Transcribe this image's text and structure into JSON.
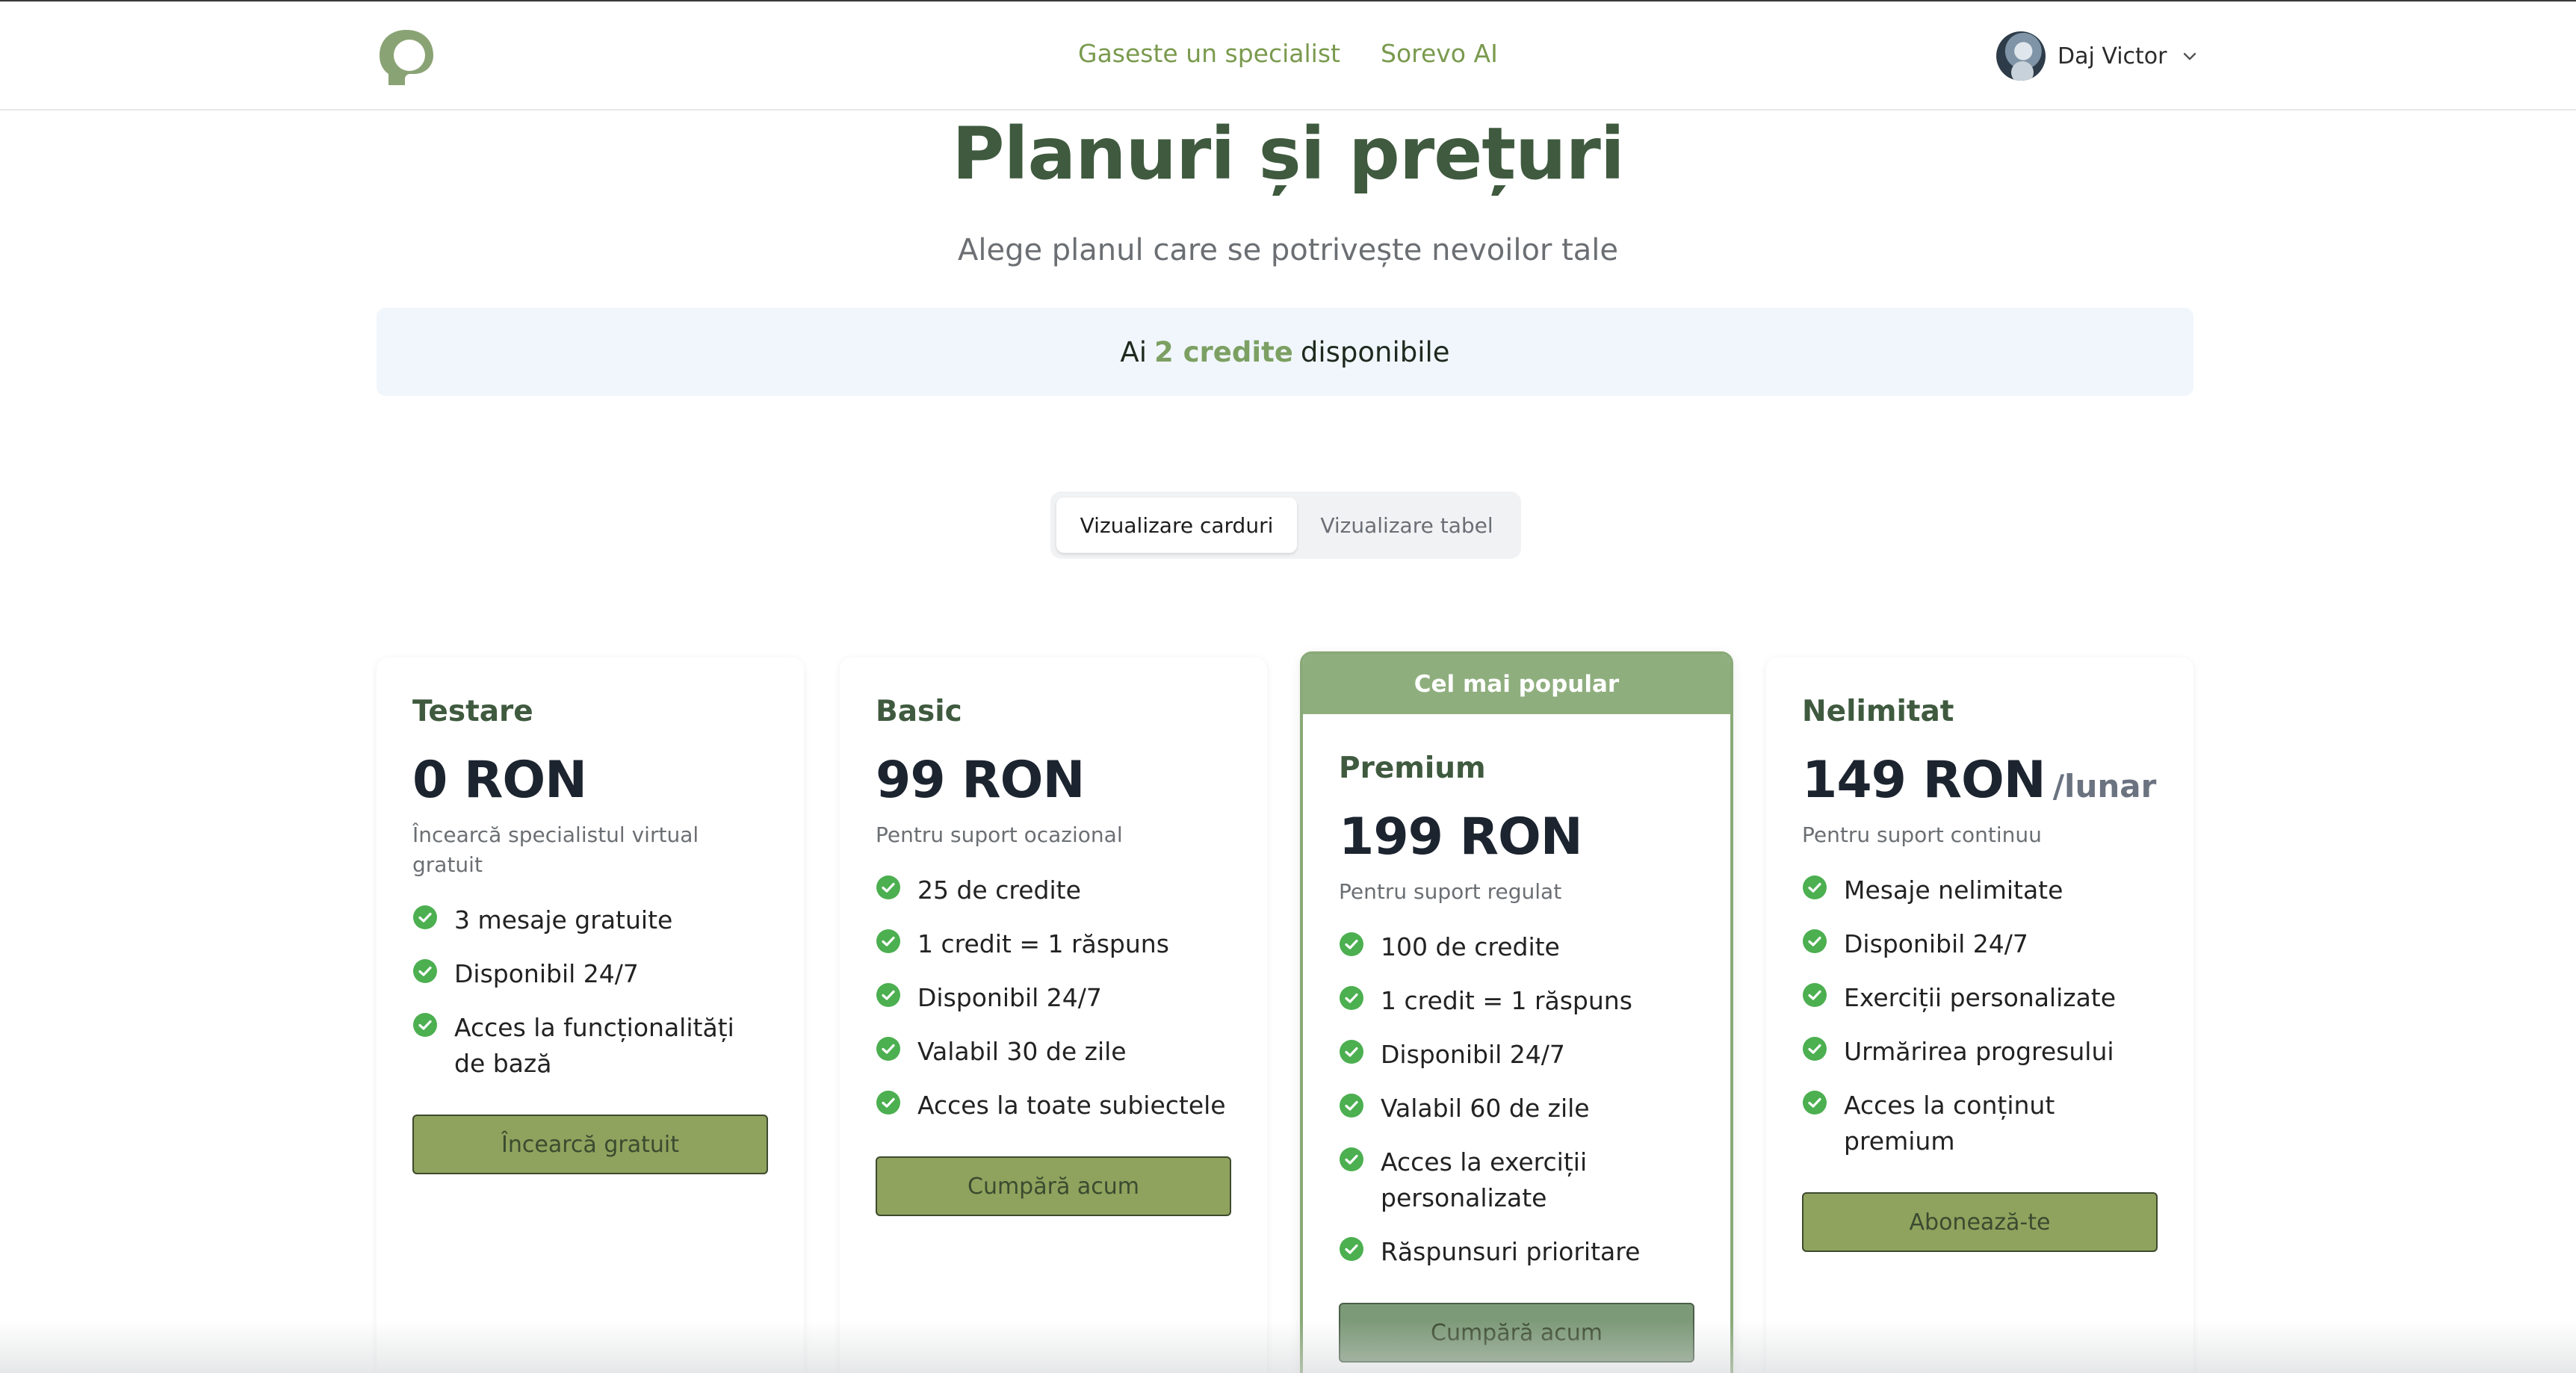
{
  "nav": {
    "links": [
      "Gaseste un specialist",
      "Sorevo AI"
    ],
    "user_name": "Daj Victor"
  },
  "hero": {
    "title": "Planuri și prețuri",
    "subtitle": "Alege planul care se potrivește nevoilor tale"
  },
  "credits": {
    "prefix": "Ai",
    "highlight": "2 credite",
    "suffix": "disponibile"
  },
  "view_toggle": {
    "cards_label": "Vizualizare carduri",
    "table_label": "Vizualizare tabel",
    "active": "cards"
  },
  "colors": {
    "brand_green": "#7ca062",
    "heading_green": "#3f5a3f",
    "ribbon_green": "#8fae7e",
    "button_olive": "#8fa35e",
    "check_green": "#4caf50",
    "credits_bg": "#f1f6fd"
  },
  "plans": [
    {
      "name": "Testare",
      "price": "0 RON",
      "period": "",
      "description": "Încearcă specialistul virtual gratuit",
      "features": [
        "3 mesaje gratuite",
        "Disponibil 24/7",
        "Acces la funcționalități de bază"
      ],
      "cta": "Încearcă gratuit",
      "featured": false
    },
    {
      "name": "Basic",
      "price": "99 RON",
      "period": "",
      "description": "Pentru suport ocazional",
      "features": [
        "25 de credite",
        "1 credit = 1 răspuns",
        "Disponibil 24/7",
        "Valabil 30 de zile",
        "Acces la toate subiectele"
      ],
      "cta": "Cumpără acum",
      "featured": false
    },
    {
      "name": "Premium",
      "badge": "Cel mai popular",
      "price": "199 RON",
      "period": "",
      "description": "Pentru suport regulat",
      "features": [
        "100 de credite",
        "1 credit = 1 răspuns",
        "Disponibil 24/7",
        "Valabil 60 de zile",
        "Acces la exerciții personalizate",
        "Răspunsuri prioritare"
      ],
      "cta": "Cumpără acum",
      "featured": true
    },
    {
      "name": "Nelimitat",
      "price": "149 RON",
      "period": "/lunar",
      "description": "Pentru suport continuu",
      "features": [
        "Mesaje nelimitate",
        "Disponibil 24/7",
        "Exerciții personalizate",
        "Urmărirea progresului",
        "Acces la conținut premium"
      ],
      "cta": "Abonează-te",
      "featured": false
    }
  ]
}
